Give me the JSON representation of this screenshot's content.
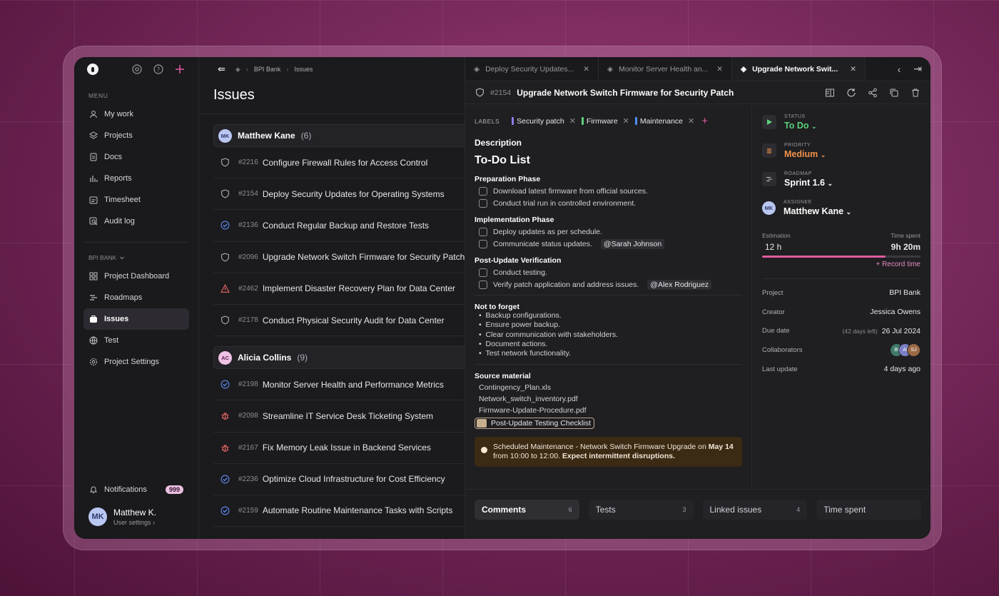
{
  "colors": {
    "accent": "#e05b9f",
    "status_green": "#5bd07a",
    "priority_orange": "#f0914a"
  },
  "sidebar": {
    "menu_label": "MENU",
    "items": [
      {
        "label": "My work",
        "icon": "user-icon"
      },
      {
        "label": "Projects",
        "icon": "layers-icon"
      },
      {
        "label": "Docs",
        "icon": "doc-icon"
      },
      {
        "label": "Reports",
        "icon": "chart-icon"
      },
      {
        "label": "Timesheet",
        "icon": "timesheet-icon"
      },
      {
        "label": "Audit log",
        "icon": "audit-icon"
      }
    ],
    "project_label": "BPI BANK",
    "project_items": [
      {
        "label": "Project Dashboard",
        "icon": "grid-icon"
      },
      {
        "label": "Roadmaps",
        "icon": "roadmap-icon"
      },
      {
        "label": "Issues",
        "icon": "issues-icon"
      },
      {
        "label": "Test",
        "icon": "test-icon"
      },
      {
        "label": "Project Settings",
        "icon": "gear-icon"
      }
    ],
    "notifications_label": "Notifications",
    "notifications_count": "999",
    "user": {
      "initials": "MK",
      "name": "Matthew K.",
      "sub": "User settings"
    }
  },
  "issues": {
    "breadcrumb": [
      "BPI Bank",
      "Issues"
    ],
    "title": "Issues",
    "groups": [
      {
        "initials": "MK",
        "name": "Matthew Kane",
        "count": "(6)",
        "rows": [
          {
            "num": "#2216",
            "title": "Configure Firewall Rules for Access Control",
            "icon": "shield-icon"
          },
          {
            "num": "#2154",
            "title": "Deploy Security Updates for Operating Systems",
            "icon": "shield-icon"
          },
          {
            "num": "#2136",
            "title": "Conduct Regular Backup and Restore Tests",
            "icon": "check-badge-icon"
          },
          {
            "num": "#2096",
            "title": "Upgrade Network Switch Firmware for Security Patch",
            "icon": "shield-icon"
          },
          {
            "num": "#2462",
            "title": "Implement Disaster Recovery Plan for Data Center",
            "icon": "warning-icon"
          },
          {
            "num": "#2178",
            "title": "Conduct Physical Security Audit for Data Center",
            "icon": "shield-icon"
          }
        ]
      },
      {
        "initials": "AC",
        "name": "Alicia Collins",
        "count": "(9)",
        "rows": [
          {
            "num": "#2198",
            "title": "Monitor Server Health and Performance Metrics",
            "icon": "check-badge-icon"
          },
          {
            "num": "#2098",
            "title": "Streamline IT Service Desk Ticketing System",
            "icon": "bug-icon"
          },
          {
            "num": "#2167",
            "title": "Fix Memory Leak Issue in Backend Services",
            "icon": "bug-icon"
          },
          {
            "num": "#2236",
            "title": "Optimize Cloud Infrastructure for Cost Efficiency",
            "icon": "check-badge-icon"
          },
          {
            "num": "#2159",
            "title": "Automate Routine Maintenance Tasks with Scripts",
            "icon": "check-badge-icon"
          }
        ]
      }
    ]
  },
  "tabs": [
    {
      "label": "Deploy Security Updates..."
    },
    {
      "label": "Monitor Server Health an..."
    },
    {
      "label": "Upgrade Network Swit..."
    }
  ],
  "detail": {
    "num": "#2154",
    "title": "Upgrade Network Switch Firmware for Security Patch",
    "labels_label": "LABELS",
    "labels": [
      {
        "name": "Security patch",
        "color": "#8a7fe8"
      },
      {
        "name": "Firmware",
        "color": "#5bd07a"
      },
      {
        "name": "Maintenance",
        "color": "#4f8ef0"
      }
    ],
    "description_label": "Description",
    "todo_title": "To-Do List",
    "phases": [
      {
        "title": "Preparation Phase",
        "items": [
          {
            "text": "Download latest firmware from official sources.",
            "mention": ""
          },
          {
            "text": "Conduct trial run in controlled environment.",
            "mention": ""
          }
        ]
      },
      {
        "title": "Implementation Phase",
        "items": [
          {
            "text": "Deploy updates as per schedule.",
            "mention": ""
          },
          {
            "text": "Communicate status updates.",
            "mention": "@Sarah Johnson"
          }
        ]
      },
      {
        "title": "Post-Update Verification",
        "items": [
          {
            "text": "Conduct testing.",
            "mention": ""
          },
          {
            "text": "Verify patch application and address issues.",
            "mention": "@Alex Rodriguez"
          }
        ]
      }
    ],
    "not_forget_title": "Not to forget",
    "not_forget": [
      "Backup configurations.",
      "Ensure power backup.",
      "Clear communication with stakeholders.",
      "Document actions.",
      "Test network functionality."
    ],
    "source_title": "Source material",
    "files": [
      "Contingency_Plan.xls",
      "Network_switch_inventory.pdf",
      "Firmware-Update-Procedure.pdf"
    ],
    "attached_file": "Post-Update Testing Checklist",
    "alert": {
      "pre": "Scheduled Maintenance - Network Switch Firmware Upgrade on ",
      "date": "May 14",
      "line2_pre": "from 10:00 to 12:00. ",
      "line2_bold": "Expect intermittent disruptions."
    }
  },
  "props": {
    "status": {
      "label": "STATUS",
      "value": "To Do"
    },
    "priority": {
      "label": "PRIORITY",
      "value": "Medium"
    },
    "roadmap": {
      "label": "ROADMAP",
      "value": "Sprint 1.6"
    },
    "assignee": {
      "label": "ASSIGNEE",
      "value": "Matthew Kane",
      "initials": "MK"
    },
    "estimation_label": "Estimation",
    "time_spent_label": "Time spent",
    "estimation": "12 h",
    "time_spent": "9h 20m",
    "time_progress": 0.78,
    "record_time": "+ Record time",
    "meta": [
      {
        "key": "Project",
        "value": "BPI Bank",
        "note": ""
      },
      {
        "key": "Creator",
        "value": "Jessica Owens",
        "note": ""
      },
      {
        "key": "Due date",
        "value": "26 Jul 2024",
        "note": "(42 days left)"
      }
    ],
    "collaborators_label": "Collaborators",
    "collaborators": [
      "BI",
      "AI",
      "SJ"
    ],
    "last_update_label": "Last update",
    "last_update": "4 days ago"
  },
  "bottom_tabs": [
    {
      "label": "Comments",
      "count": "6"
    },
    {
      "label": "Tests",
      "count": "3"
    },
    {
      "label": "Linked issues",
      "count": "4"
    },
    {
      "label": "Time spent",
      "count": ""
    }
  ]
}
